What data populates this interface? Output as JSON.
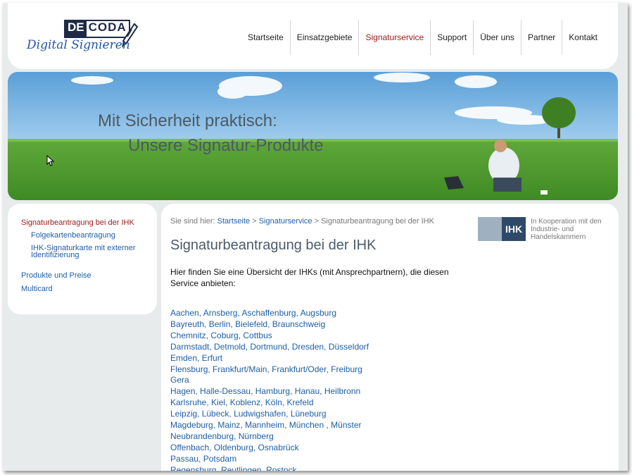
{
  "logo": {
    "brand_left": "DE",
    "brand_right": "CODA",
    "script": "Digital Signieren"
  },
  "nav": {
    "items": [
      "Startseite",
      "Einsatzgebiete",
      "Signaturservice",
      "Support",
      "Über uns",
      "Partner",
      "Kontakt"
    ],
    "active": "Signaturservice"
  },
  "banner": {
    "line1": "Mit Sicherheit praktisch:",
    "line2": "Unsere Signatur-Produkte"
  },
  "sidebar": {
    "items": [
      "Signaturbeantragung bei der IHK",
      "Folgekartenbeantragung",
      "IHK-Signaturkarte mit externer Identifizierung",
      "Produkte und Preise",
      "Multicard"
    ],
    "active": "Signaturbeantragung bei der IHK"
  },
  "breadcrumb": {
    "prefix": "Sie sind hier:",
    "links": [
      "Startseite",
      "Signaturservice"
    ],
    "separator": ">",
    "current": "Signaturbeantragung bei der IHK"
  },
  "main": {
    "title": "Signaturbeantragung bei der IHK",
    "intro": "Hier finden Sie eine Übersicht der IHKs (mit Ansprechpartnern), die diesen Service anbieten:"
  },
  "ihk": {
    "logo_text": "IHK",
    "caption": "In Kooperation mit den Industrie- und Handelskammern"
  },
  "cities": [
    [
      "Aachen",
      "Arnsberg",
      "Aschaffenburg",
      "Augsburg"
    ],
    [
      "Bayreuth",
      "Berlin",
      "Bielefeld",
      "Braunschweig"
    ],
    [
      "Chemnitz",
      "Coburg",
      "Cottbus"
    ],
    [
      "Darmstadt",
      "Detmold",
      "Dortmund",
      "Dresden",
      "Düsseldorf"
    ],
    [
      "Emden",
      "Erfurt"
    ],
    [
      "Flensburg",
      "Frankfurt/Main",
      "Frankfurt/Oder",
      "Freiburg"
    ],
    [
      "Gera"
    ],
    [
      "Hagen",
      "Halle-Dessau",
      "Hamburg",
      "Hanau",
      "Heilbronn"
    ],
    [
      "Karlsruhe",
      "Kiel",
      "Koblenz",
      "Köln",
      "Krefeld"
    ],
    [
      "Leipzig",
      "Lübeck",
      "Ludwigshafen",
      "Lüneburg"
    ],
    [
      "Magdeburg",
      "Mainz",
      "Mannheim",
      "München ",
      "Münster"
    ],
    [
      "Neubrandenburg",
      "Nürnberg"
    ],
    [
      "Offenbach",
      "Oldenburg",
      "Osnabrück"
    ],
    [
      "Passau",
      "Potsdam"
    ],
    [
      "Regensburg",
      "Reutlingen",
      "Rostock"
    ]
  ],
  "colors": {
    "link": "#1d5fa8",
    "active": "#9c1a1a",
    "title": "#4b5a6a",
    "page_bg": "#e8ebec"
  }
}
